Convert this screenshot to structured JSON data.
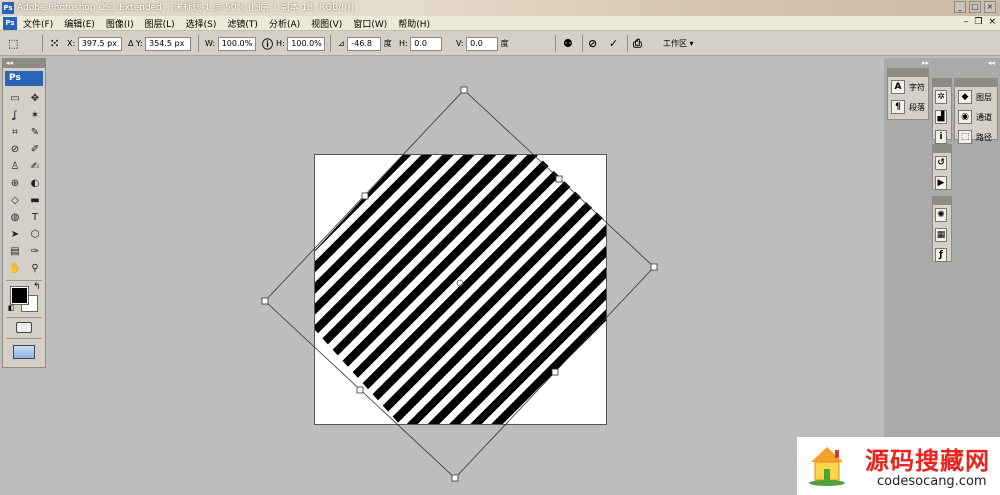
{
  "window": {
    "title": "Adobe Photoshop CS3 Extended - [未标题-1 @ 50% (图层 1 副本 18, RGB/8)]",
    "app_icon": "Ps"
  },
  "menu": {
    "items": [
      "文件(F)",
      "编辑(E)",
      "图像(I)",
      "图层(L)",
      "选择(S)",
      "滤镜(T)",
      "分析(A)",
      "视图(V)",
      "窗口(W)",
      "帮助(H)"
    ]
  },
  "options": {
    "x_label": "X:",
    "x_value": "397.5 px",
    "delta_symbol": "Δ",
    "y_label": "Y:",
    "y_value": "354.5 px",
    "w_label": "W:",
    "w_value": "100.0%",
    "h_label": "H:",
    "h_value": "100.0%",
    "angle_symbol": "⊿",
    "angle_value": "-46.8",
    "deg_unit": "度",
    "hskew_label": "H:",
    "hskew_value": "0.0",
    "vskew_label": "V:",
    "vskew_value": "0.0",
    "deg_unit2": "度",
    "workspace_label": "工作区 ▾"
  },
  "toolbox": {
    "logo": "Ps",
    "tools": [
      "▭",
      "✥",
      "ʆ",
      "✶",
      "⌗",
      "✎",
      "⊘",
      "✐",
      "♙",
      "✍",
      "⊕",
      "◐",
      "◇",
      "▬",
      "◍",
      "●",
      "✒",
      "T",
      "➤",
      "⬡",
      "▤",
      "✑",
      "✋",
      "⚲"
    ]
  },
  "panels": {
    "character_label": "字符",
    "paragraph_label": "段落",
    "layers_label": "图层",
    "channels_label": "通道",
    "paths_label": "路径"
  },
  "watermark": {
    "brand_cn": "源码搜藏网",
    "url": "codesocang.com"
  },
  "colors": {
    "foreground": "#000000",
    "background": "#ffffff",
    "workspace": "#bdbdbd",
    "watermark_red": "#e8241f"
  }
}
